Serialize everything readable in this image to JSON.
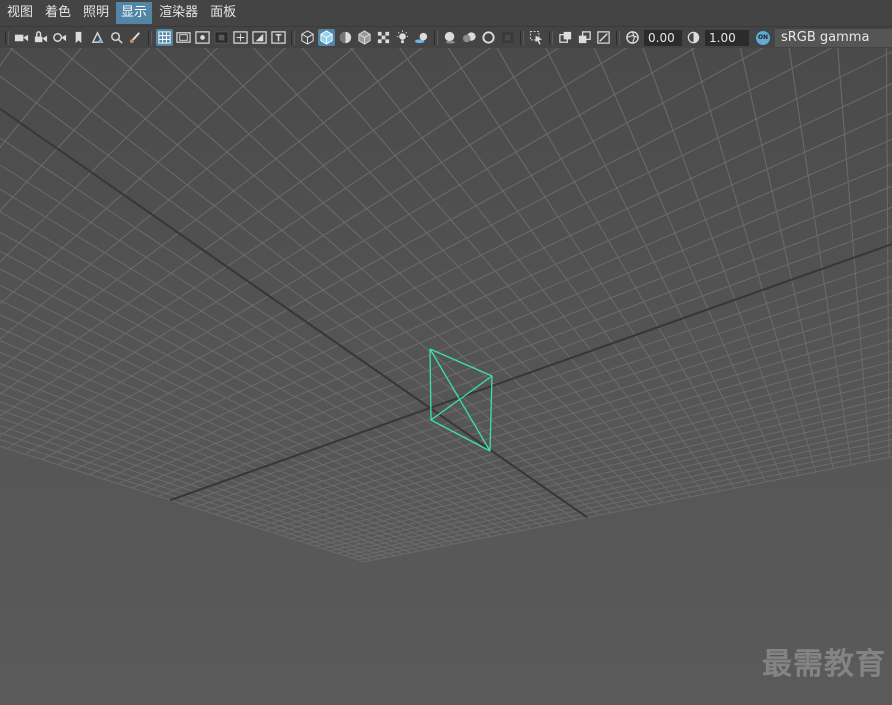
{
  "menu": {
    "items": [
      {
        "label": "视图",
        "active": false
      },
      {
        "label": "着色",
        "active": false
      },
      {
        "label": "照明",
        "active": false
      },
      {
        "label": "显示",
        "active": true
      },
      {
        "label": "渲染器",
        "active": false
      },
      {
        "label": "面板",
        "active": false
      }
    ]
  },
  "toolbar": {
    "gamma_value": "0.00",
    "exposure_value": "1.00",
    "color_mgmt_badge": "ON",
    "color_space": "sRGB gamma"
  },
  "colors": {
    "accent": "#5285a6",
    "background": "#444444",
    "viewport_bg": "#575757",
    "grid_line": "#6b6b6b",
    "grid_axis": "#373737",
    "selection_wireframe": "#39e2a4"
  },
  "watermark": "最需教育"
}
